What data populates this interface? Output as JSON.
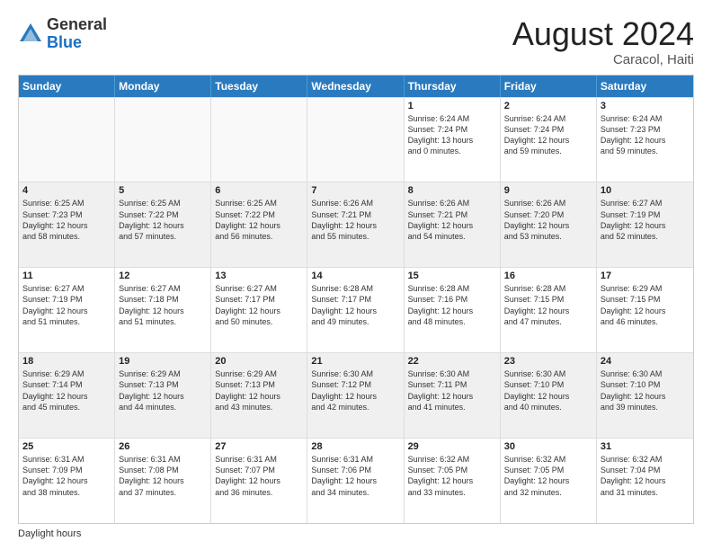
{
  "header": {
    "logo_general": "General",
    "logo_blue": "Blue",
    "month_year": "August 2024",
    "location": "Caracol, Haiti"
  },
  "footer": {
    "label": "Daylight hours"
  },
  "calendar": {
    "days_of_week": [
      "Sunday",
      "Monday",
      "Tuesday",
      "Wednesday",
      "Thursday",
      "Friday",
      "Saturday"
    ],
    "rows": [
      [
        {
          "day": "",
          "info": "",
          "empty": true
        },
        {
          "day": "",
          "info": "",
          "empty": true
        },
        {
          "day": "",
          "info": "",
          "empty": true
        },
        {
          "day": "",
          "info": "",
          "empty": true
        },
        {
          "day": "1",
          "info": "Sunrise: 6:24 AM\nSunset: 7:24 PM\nDaylight: 13 hours\nand 0 minutes."
        },
        {
          "day": "2",
          "info": "Sunrise: 6:24 AM\nSunset: 7:24 PM\nDaylight: 12 hours\nand 59 minutes."
        },
        {
          "day": "3",
          "info": "Sunrise: 6:24 AM\nSunset: 7:23 PM\nDaylight: 12 hours\nand 59 minutes."
        }
      ],
      [
        {
          "day": "4",
          "info": "Sunrise: 6:25 AM\nSunset: 7:23 PM\nDaylight: 12 hours\nand 58 minutes."
        },
        {
          "day": "5",
          "info": "Sunrise: 6:25 AM\nSunset: 7:22 PM\nDaylight: 12 hours\nand 57 minutes."
        },
        {
          "day": "6",
          "info": "Sunrise: 6:25 AM\nSunset: 7:22 PM\nDaylight: 12 hours\nand 56 minutes."
        },
        {
          "day": "7",
          "info": "Sunrise: 6:26 AM\nSunset: 7:21 PM\nDaylight: 12 hours\nand 55 minutes."
        },
        {
          "day": "8",
          "info": "Sunrise: 6:26 AM\nSunset: 7:21 PM\nDaylight: 12 hours\nand 54 minutes."
        },
        {
          "day": "9",
          "info": "Sunrise: 6:26 AM\nSunset: 7:20 PM\nDaylight: 12 hours\nand 53 minutes."
        },
        {
          "day": "10",
          "info": "Sunrise: 6:27 AM\nSunset: 7:19 PM\nDaylight: 12 hours\nand 52 minutes."
        }
      ],
      [
        {
          "day": "11",
          "info": "Sunrise: 6:27 AM\nSunset: 7:19 PM\nDaylight: 12 hours\nand 51 minutes."
        },
        {
          "day": "12",
          "info": "Sunrise: 6:27 AM\nSunset: 7:18 PM\nDaylight: 12 hours\nand 51 minutes."
        },
        {
          "day": "13",
          "info": "Sunrise: 6:27 AM\nSunset: 7:17 PM\nDaylight: 12 hours\nand 50 minutes."
        },
        {
          "day": "14",
          "info": "Sunrise: 6:28 AM\nSunset: 7:17 PM\nDaylight: 12 hours\nand 49 minutes."
        },
        {
          "day": "15",
          "info": "Sunrise: 6:28 AM\nSunset: 7:16 PM\nDaylight: 12 hours\nand 48 minutes."
        },
        {
          "day": "16",
          "info": "Sunrise: 6:28 AM\nSunset: 7:15 PM\nDaylight: 12 hours\nand 47 minutes."
        },
        {
          "day": "17",
          "info": "Sunrise: 6:29 AM\nSunset: 7:15 PM\nDaylight: 12 hours\nand 46 minutes."
        }
      ],
      [
        {
          "day": "18",
          "info": "Sunrise: 6:29 AM\nSunset: 7:14 PM\nDaylight: 12 hours\nand 45 minutes."
        },
        {
          "day": "19",
          "info": "Sunrise: 6:29 AM\nSunset: 7:13 PM\nDaylight: 12 hours\nand 44 minutes."
        },
        {
          "day": "20",
          "info": "Sunrise: 6:29 AM\nSunset: 7:13 PM\nDaylight: 12 hours\nand 43 minutes."
        },
        {
          "day": "21",
          "info": "Sunrise: 6:30 AM\nSunset: 7:12 PM\nDaylight: 12 hours\nand 42 minutes."
        },
        {
          "day": "22",
          "info": "Sunrise: 6:30 AM\nSunset: 7:11 PM\nDaylight: 12 hours\nand 41 minutes."
        },
        {
          "day": "23",
          "info": "Sunrise: 6:30 AM\nSunset: 7:10 PM\nDaylight: 12 hours\nand 40 minutes."
        },
        {
          "day": "24",
          "info": "Sunrise: 6:30 AM\nSunset: 7:10 PM\nDaylight: 12 hours\nand 39 minutes."
        }
      ],
      [
        {
          "day": "25",
          "info": "Sunrise: 6:31 AM\nSunset: 7:09 PM\nDaylight: 12 hours\nand 38 minutes."
        },
        {
          "day": "26",
          "info": "Sunrise: 6:31 AM\nSunset: 7:08 PM\nDaylight: 12 hours\nand 37 minutes."
        },
        {
          "day": "27",
          "info": "Sunrise: 6:31 AM\nSunset: 7:07 PM\nDaylight: 12 hours\nand 36 minutes."
        },
        {
          "day": "28",
          "info": "Sunrise: 6:31 AM\nSunset: 7:06 PM\nDaylight: 12 hours\nand 34 minutes."
        },
        {
          "day": "29",
          "info": "Sunrise: 6:32 AM\nSunset: 7:05 PM\nDaylight: 12 hours\nand 33 minutes."
        },
        {
          "day": "30",
          "info": "Sunrise: 6:32 AM\nSunset: 7:05 PM\nDaylight: 12 hours\nand 32 minutes."
        },
        {
          "day": "31",
          "info": "Sunrise: 6:32 AM\nSunset: 7:04 PM\nDaylight: 12 hours\nand 31 minutes."
        }
      ]
    ]
  }
}
